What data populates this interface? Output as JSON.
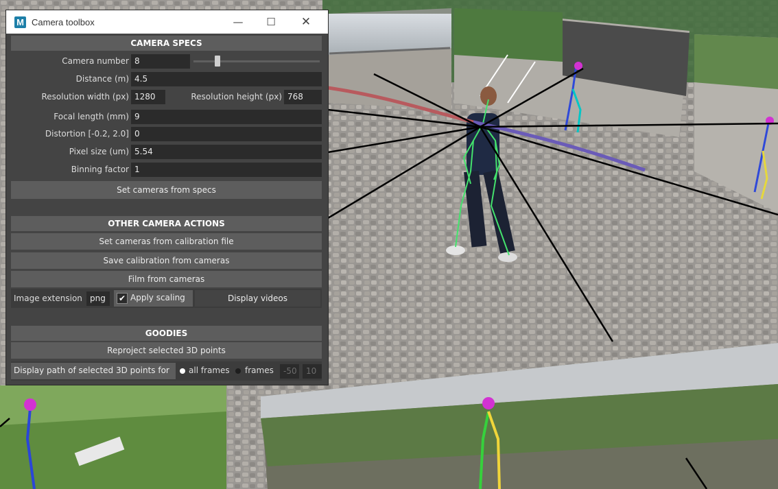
{
  "window": {
    "title": "Camera toolbox",
    "app_icon_letter": "M",
    "minimize_glyph": "—",
    "maximize_glyph": "☐",
    "close_glyph": "✕"
  },
  "camera_specs": {
    "header": "CAMERA SPECS",
    "camera_number_label": "Camera number",
    "camera_number": "8",
    "distance_label": "Distance (m)",
    "distance": "4.5",
    "res_width_label": "Resolution width (px)",
    "res_width": "1280",
    "res_height_label": "Resolution height (px)",
    "res_height": "768",
    "focal_label": "Focal length (mm)",
    "focal": "9",
    "distortion_label": "Distortion [-0.2, 2.0]",
    "distortion": "0",
    "pixel_size_label": "Pixel size (um)",
    "pixel_size": "5.54",
    "binning_label": "Binning factor",
    "binning": "1",
    "set_button": "Set cameras from specs"
  },
  "other_actions": {
    "header": "OTHER CAMERA ACTIONS",
    "from_calibration": "Set cameras from calibration file",
    "save_calibration": "Save calibration from cameras",
    "film": "Film from cameras",
    "image_ext_label": "Image extension",
    "image_ext": "png",
    "apply_scaling": "Apply scaling",
    "display_videos": "Display videos"
  },
  "goodies": {
    "header": "GOODIES",
    "reproject": "Reproject selected 3D points",
    "display_path_label": "Display path of selected 3D points for",
    "all_frames": "all frames",
    "frames": "frames",
    "frame_start": "-50",
    "frame_end": "10"
  },
  "colors": {
    "panel_bg": "#444444",
    "header_bg": "#5d5d5d",
    "field_bg": "#2b2b2b",
    "path_red": "#b85a5e",
    "path_blue": "#6a5bb8"
  }
}
